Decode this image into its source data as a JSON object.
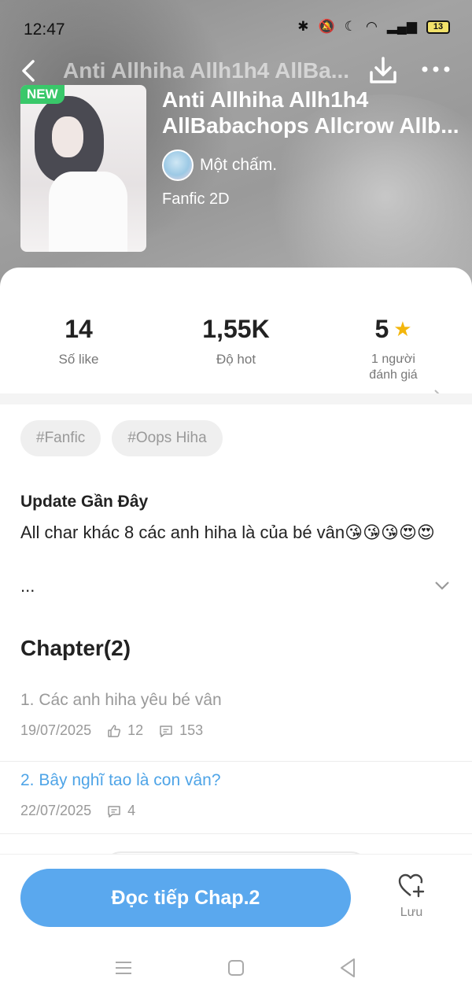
{
  "status_bar": {
    "time": "12:47",
    "battery": "13"
  },
  "nav": {
    "title": "Anti Allhiha Allh1h4 AllBa..."
  },
  "book": {
    "badge": "NEW",
    "title_line1": "Anti Allhiha Allh1h4",
    "title_line2": "AllBabachops Allcrow Allb...",
    "author": "Một chấm.",
    "genre": "Fanfic 2D"
  },
  "stats": {
    "likes": {
      "value": "14",
      "label": "Số like"
    },
    "hot": {
      "value": "1,55K",
      "label": "Độ hot"
    },
    "rating": {
      "value": "5",
      "label_line1": "1 người",
      "label_line2": "đánh giá"
    }
  },
  "tags": [
    "#Fanfic",
    "#Oops Hiha"
  ],
  "update": {
    "heading": "Update Gần Đây",
    "text": "All char khác 8 các anh hiha là của bé vân😘😘😘😍😍",
    "ellipsis": "..."
  },
  "chapters": {
    "heading": "Chapter(2)",
    "items": [
      {
        "title": "1. Các anh hiha yêu bé vân",
        "date": "19/07/2025",
        "likes": "12",
        "comments": "153"
      },
      {
        "title": "2. Bây nghĩ tao là con vân?",
        "date": "22/07/2025",
        "comments": "4"
      }
    ]
  },
  "footer": {
    "read_button": "Đọc tiếp Chap.2",
    "save_label": "Lưu"
  },
  "colors": {
    "accent": "#5aa8ee",
    "badge_green": "#39c86a",
    "star": "#f3b60c"
  }
}
